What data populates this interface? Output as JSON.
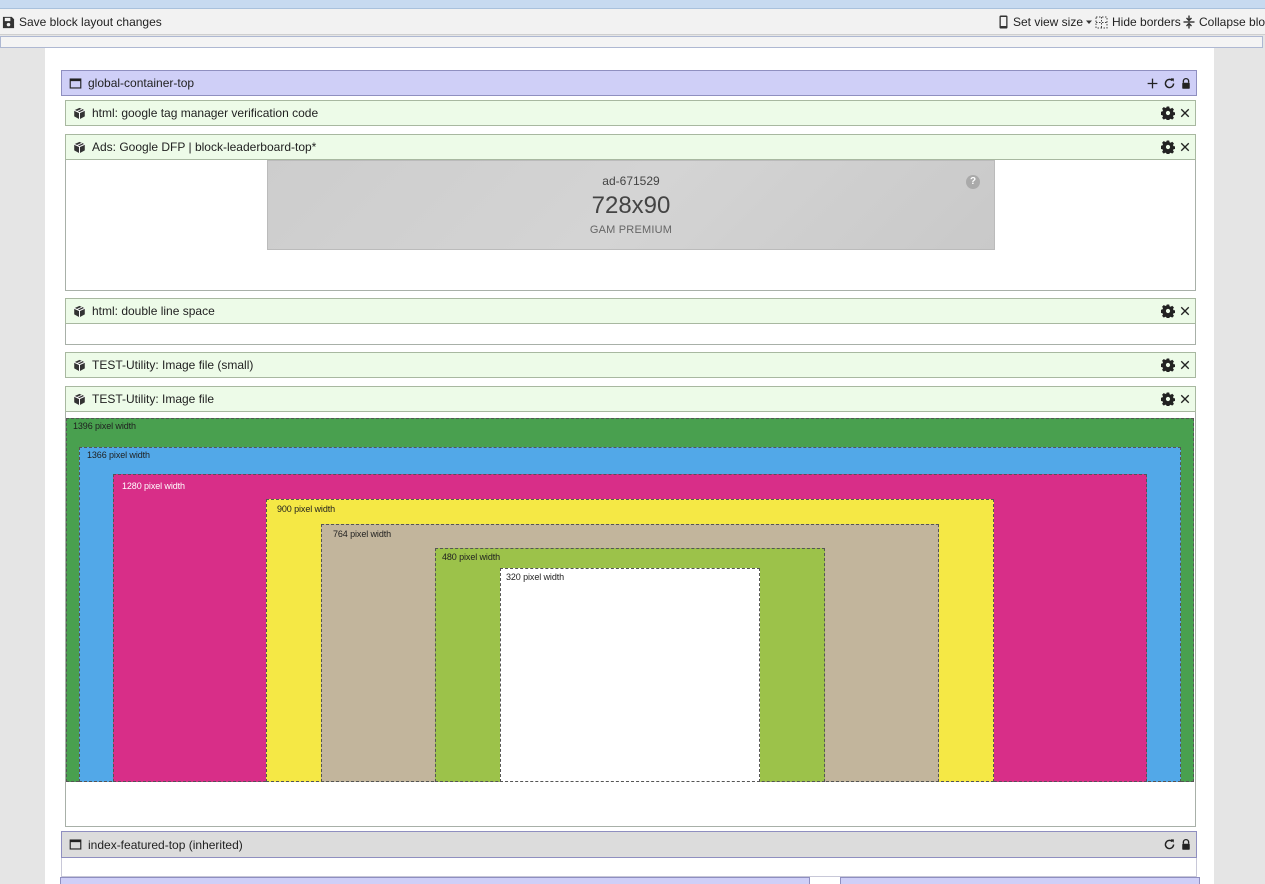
{
  "toolbar": {
    "save_label": "Save block layout changes",
    "view_size_label": "Set view size",
    "hide_borders_label": "Hide borders",
    "collapse_label": "Collapse bloc"
  },
  "containers": {
    "top": {
      "label": "global-container-top"
    },
    "featured": {
      "label": "index-featured-top (inherited)"
    }
  },
  "blocks": [
    {
      "label": "html: google tag manager verification code"
    },
    {
      "label": "Ads: Google DFP | block-leaderboard-top*"
    },
    {
      "label": "html: double line space"
    },
    {
      "label": "TEST-Utility: Image file (small)"
    },
    {
      "label": "TEST-Utility: Image file"
    }
  ],
  "ad": {
    "id": "ad-671529",
    "size": "728x90",
    "label": "GAM PREMIUM",
    "help": "?"
  },
  "zones": [
    {
      "label": "1396 pixel width",
      "color": "#49a04f",
      "label_color": "#1f1f1f"
    },
    {
      "label": "1366 pixel width",
      "color": "#52a8e8",
      "label_color": "#1f1f1f"
    },
    {
      "label": "1280 pixel width",
      "color": "#d82e88",
      "label_color": "#ffffff"
    },
    {
      "label": "900 pixel width",
      "color": "#f5e845",
      "label_color": "#1f1f1f"
    },
    {
      "label": "764 pixel width",
      "color": "#c2b59c",
      "label_color": "#1f1f1f"
    },
    {
      "label": "480 pixel width",
      "color": "#9cc24a",
      "label_color": "#1f1f1f"
    },
    {
      "label": "320 pixel width",
      "color": "#ffffff",
      "label_color": "#1f1f1f"
    }
  ]
}
